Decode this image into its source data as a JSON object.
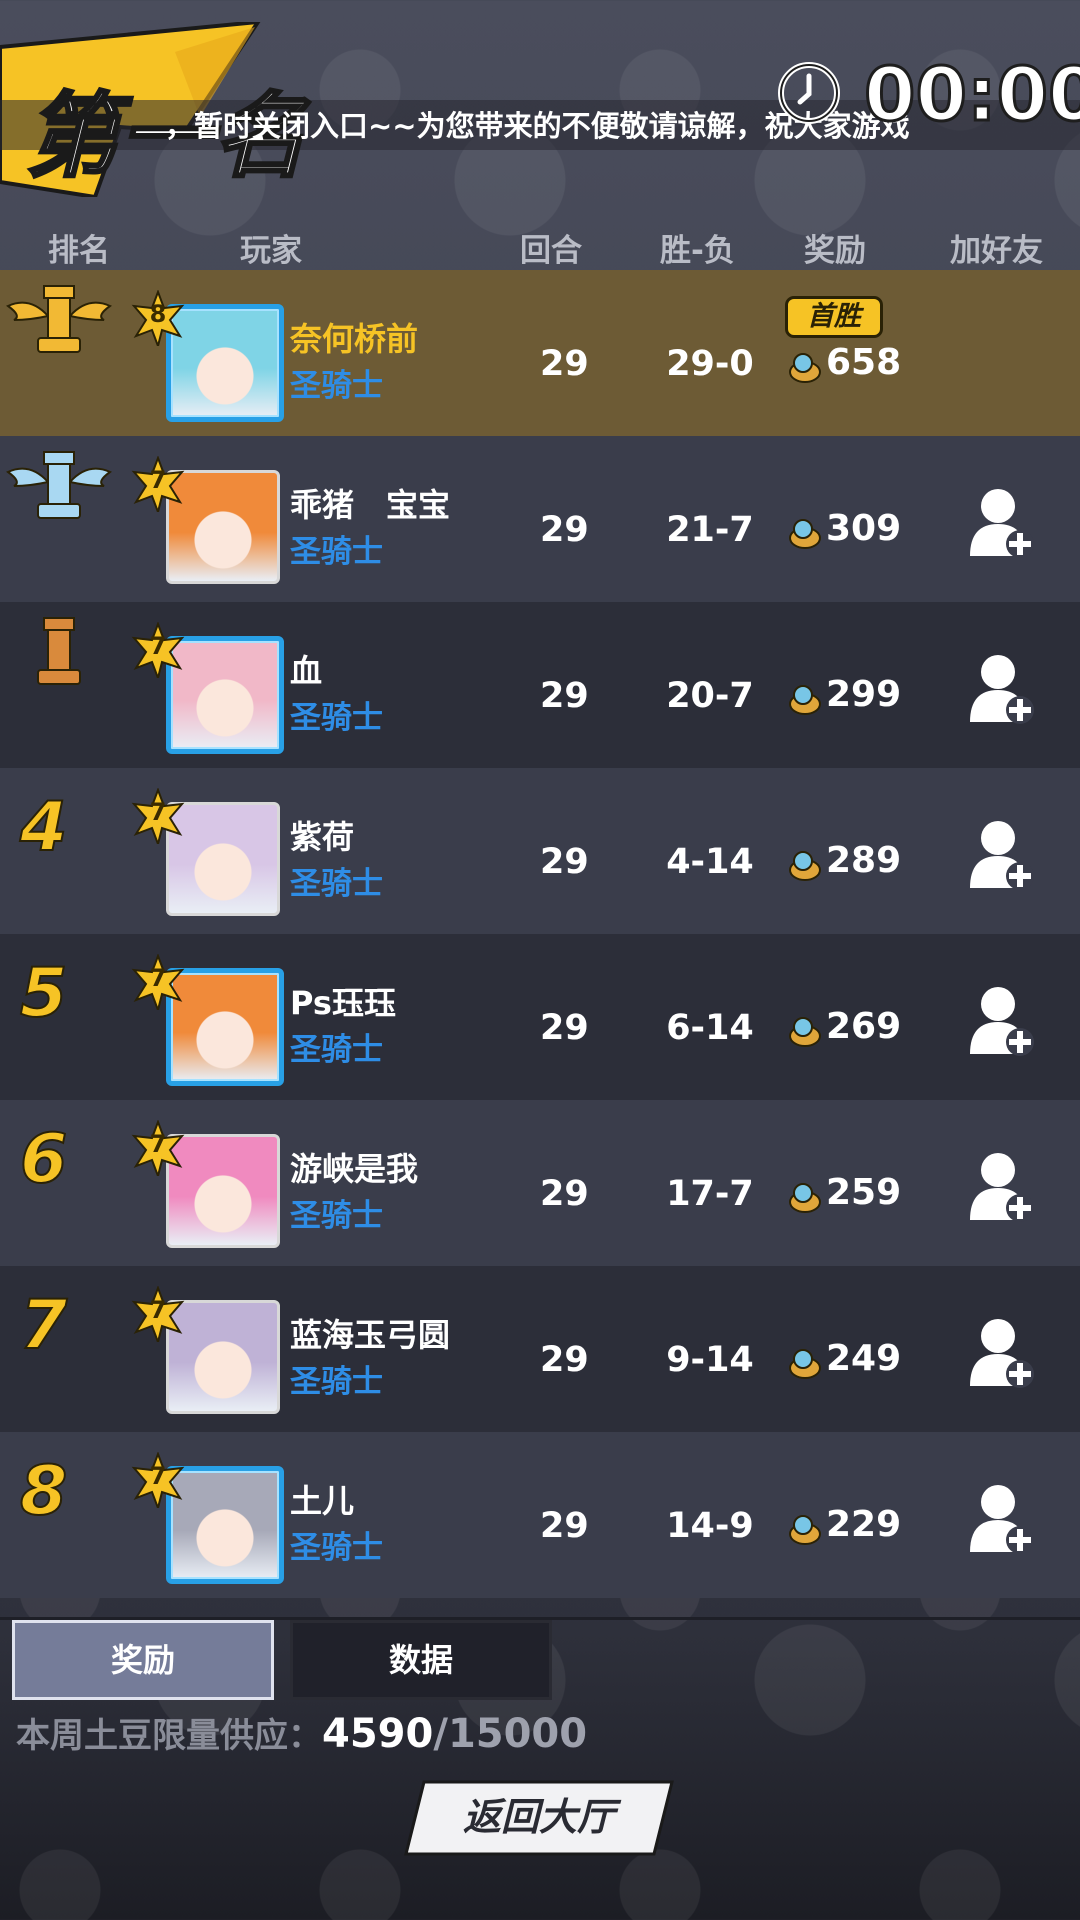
{
  "header": {
    "rank_title": "第一名",
    "marquee": "，暂时关闭入口~~为您带来的不便敬请谅解，祝大家游戏",
    "timer": "00:00"
  },
  "columns": {
    "rank": "排名",
    "player": "玩家",
    "rounds": "回合",
    "record": "胜-负",
    "reward": "奖励",
    "add_friend": "加好友"
  },
  "rows": [
    {
      "rank": "1",
      "rank_style": "gold-icon",
      "level": "8",
      "name": "奈何桥前",
      "class": "圣骑士",
      "rounds": "29",
      "record": "29-0",
      "reward": "658",
      "badge": "首胜",
      "avatar_color": "#7fd4e6"
    },
    {
      "rank": "2",
      "rank_style": "silver-icon",
      "level": "7",
      "name": "乖猪　宝宝",
      "class": "圣骑士",
      "rounds": "29",
      "record": "21-7",
      "reward": "309",
      "avatar_color": "#f08a3a"
    },
    {
      "rank": "3",
      "rank_style": "bronze-icon",
      "level": "7",
      "name": "血",
      "class": "圣骑士",
      "rounds": "29",
      "record": "20-7",
      "reward": "299",
      "avatar_color": "#f1b8c8"
    },
    {
      "rank": "4",
      "level": "7",
      "name": "紫荷",
      "class": "圣骑士",
      "rounds": "29",
      "record": "4-14",
      "reward": "289",
      "avatar_color": "#d8c6e6"
    },
    {
      "rank": "5",
      "level": "7",
      "name": "Ps珏珏",
      "class": "圣骑士",
      "rounds": "29",
      "record": "6-14",
      "reward": "269",
      "avatar_color": "#f08a3a"
    },
    {
      "rank": "6",
      "level": "7",
      "name": "游峡是我",
      "class": "圣骑士",
      "rounds": "29",
      "record": "17-7",
      "reward": "259",
      "avatar_color": "#f08abf"
    },
    {
      "rank": "7",
      "level": "7",
      "name": "蓝海玉弓圆",
      "class": "圣骑士",
      "rounds": "29",
      "record": "9-14",
      "reward": "249",
      "avatar_color": "#bfb2d6"
    },
    {
      "rank": "8",
      "level": "7",
      "name": "土儿",
      "class": "圣骑士",
      "rounds": "29",
      "record": "14-9",
      "reward": "229",
      "avatar_color": "#a7a9b8"
    }
  ],
  "tabs": {
    "reward": "奖励",
    "data": "数据"
  },
  "supply": {
    "label": "本周土豆限量供应：",
    "current": "4590",
    "total": "/15000"
  },
  "back_button": "返回大厅",
  "colors": {
    "accent_gold": "#f6c325",
    "class_blue": "#2e8de6",
    "first_row": "#6d5b35"
  }
}
